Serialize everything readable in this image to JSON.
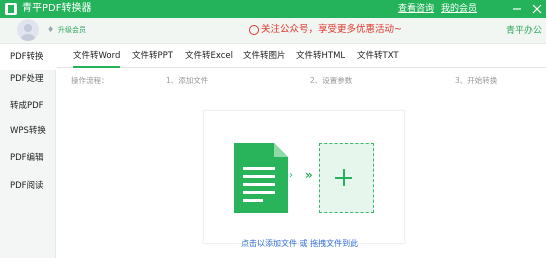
{
  "app": {
    "title": "青平PDF转换器",
    "links": {
      "help": "查看咨询",
      "account": "我的会员"
    },
    "controls": {
      "minimize": "−",
      "close": "×"
    }
  },
  "header": {
    "vip_label": "升级会员",
    "promo_text": "关注公众号，享受更多优惠活动~",
    "brand": "青平办公"
  },
  "sidebar": {
    "items": [
      {
        "label": "PDF转换"
      },
      {
        "label": "PDF处理"
      },
      {
        "label": "转成PDF"
      },
      {
        "label": "WPS转换"
      },
      {
        "label": "PDF编辑"
      },
      {
        "label": "PDF阅读"
      }
    ]
  },
  "tabs": [
    {
      "label": "文件转Word"
    },
    {
      "label": "文件转PPT"
    },
    {
      "label": "文件转Excel"
    },
    {
      "label": "文件转图片"
    },
    {
      "label": "文件转HTML"
    },
    {
      "label": "文件转TXT"
    }
  ],
  "steps": {
    "prefix": "操作流程：",
    "step1": "1、添加文件",
    "step2": "2、设置参数",
    "step3": "3、开始转换"
  },
  "dropzone": {
    "hint": "点击以添加文件 或 拖拽文件到此"
  },
  "colors": {
    "accent": "#24b35a",
    "promo": "#e0352b",
    "link": "#2f6fd6"
  }
}
